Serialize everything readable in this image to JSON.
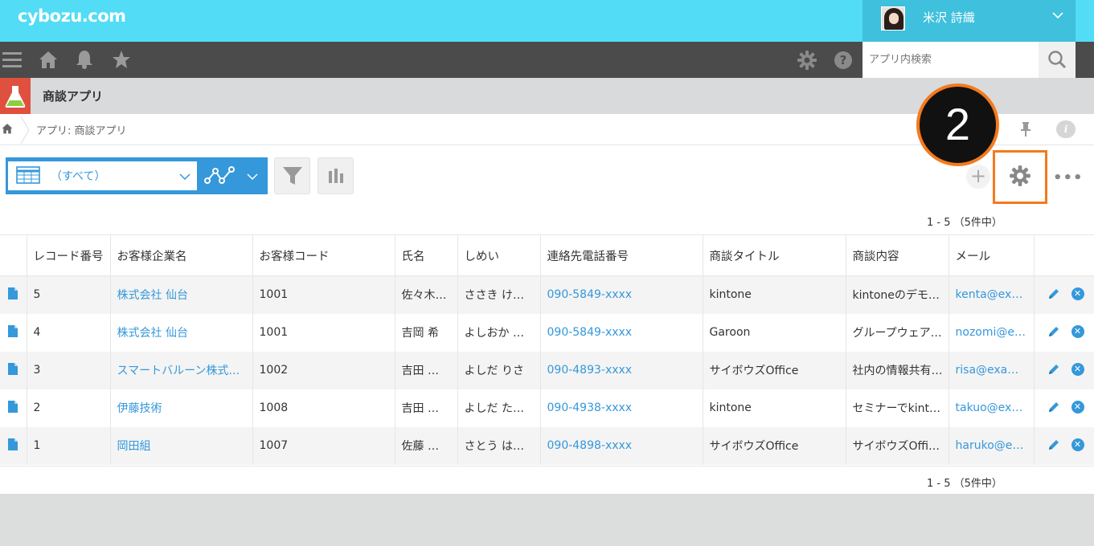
{
  "header": {
    "logo": "cybozu.com",
    "user_name": "米沢 詩織"
  },
  "navbar": {
    "search_placeholder": "アプリ内検索"
  },
  "app": {
    "title": "商談アプリ",
    "breadcrumb": "アプリ: 商談アプリ"
  },
  "toolbar": {
    "view_label": "（すべて）",
    "step_badge": "2",
    "pager_top": "1 - 5 （5件中）",
    "pager_bottom": "1 - 5 （5件中）"
  },
  "table": {
    "columns": [
      "レコード番号",
      "お客様企業名",
      "お客様コード",
      "氏名",
      "しめい",
      "連絡先電話番号",
      "商談タイトル",
      "商談内容",
      "メール"
    ],
    "rows": [
      [
        "5",
        "株式会社 仙台",
        "1001",
        "佐々木…",
        "ささき け…",
        "090-5849-xxxx",
        "kintone",
        "kintoneのデモ…",
        "kenta@ex…"
      ],
      [
        "4",
        "株式会社 仙台",
        "1001",
        "吉岡 希",
        "よしおか …",
        "090-5849-xxxx",
        "Garoon",
        "グループウェア…",
        "nozomi@e…"
      ],
      [
        "3",
        "スマートバルーン株式…",
        "1002",
        "吉田 …",
        "よしだ りさ",
        "090-4893-xxxx",
        "サイボウズOffice",
        "社内の情報共有…",
        "risa@exa…"
      ],
      [
        "2",
        "伊藤技術",
        "1008",
        "吉田 …",
        "よしだ た…",
        "090-4938-xxxx",
        "kintone",
        "セミナーでkint…",
        "takuo@ex…"
      ],
      [
        "1",
        "岡田組",
        "1007",
        "佐藤 …",
        "さとう は…",
        "090-4898-xxxx",
        "サイボウズOffice",
        "サイボウズOffi…",
        "haruko@e…"
      ]
    ]
  },
  "colors": {
    "topbar": "#52dcf5",
    "navbar": "#4b4b4b",
    "accent": "#3498db",
    "highlight": "#f47a1c",
    "app_icon": "#e0503f"
  }
}
